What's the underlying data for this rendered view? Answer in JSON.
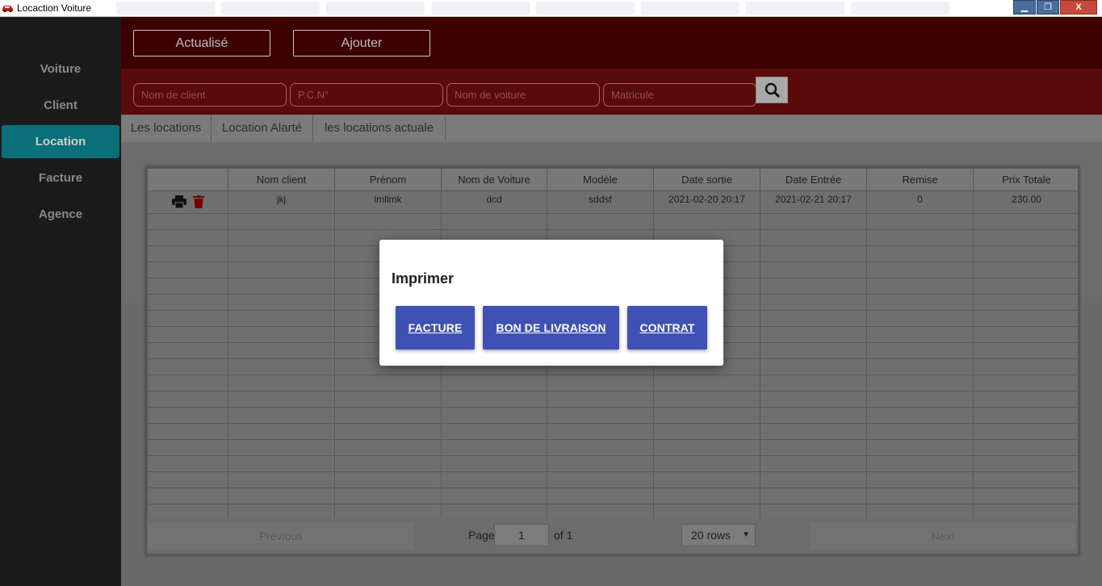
{
  "window": {
    "title": "Locaction Voiture",
    "controls": {
      "minimize": "▁",
      "maximize": "❐",
      "close": "X"
    }
  },
  "sidebar": {
    "items": [
      {
        "label": "Voiture"
      },
      {
        "label": "Client"
      },
      {
        "label": "Location",
        "active": true
      },
      {
        "label": "Facture"
      },
      {
        "label": "Agence"
      }
    ]
  },
  "toolbar": {
    "refresh_label": "Actualisé",
    "add_label": "Ajouter"
  },
  "search": {
    "client_placeholder": "Nom de client",
    "pcn_placeholder": "P.C.N°",
    "car_placeholder": "Nom de voiture",
    "plate_placeholder": "Matricule",
    "button_icon": "search-icon"
  },
  "tabs": [
    {
      "label": "Les locations",
      "active": true
    },
    {
      "label": "Location Alarté"
    },
    {
      "label": "les locations actuale"
    }
  ],
  "table": {
    "columns": [
      "",
      "Nom client",
      "Prénom",
      "Nom de Voiture",
      "Modèle",
      "Date sortie",
      "Date Entrée",
      "Remise",
      "Prix Totale"
    ],
    "rows": [
      {
        "nom_client": "jkj",
        "prenom": "lmllmk",
        "nom_voiture": "dcd",
        "modele": "sddsf",
        "date_sortie": "2021-02-20 20:17",
        "date_entree": "2021-02-21 20:17",
        "remise": "0",
        "prix_totale": "230.00"
      }
    ],
    "row_actions": [
      "print-icon",
      "trash-icon"
    ]
  },
  "pagination": {
    "previous_label": "Previous",
    "page_label": "Page",
    "page_value": "1",
    "of_label": "of 1",
    "rows_selected": "20 rows",
    "next_label": "Next"
  },
  "dialog": {
    "title": "Imprimer",
    "buttons": [
      "FACTURE",
      "BON DE LIVRAISON",
      "CONTRAT"
    ]
  },
  "colors": {
    "toolbar_bg": "#3d0000",
    "search_bg": "#5b0a0a",
    "sidebar_active": "#0a6f78",
    "dialog_button": "#3f51b5"
  }
}
